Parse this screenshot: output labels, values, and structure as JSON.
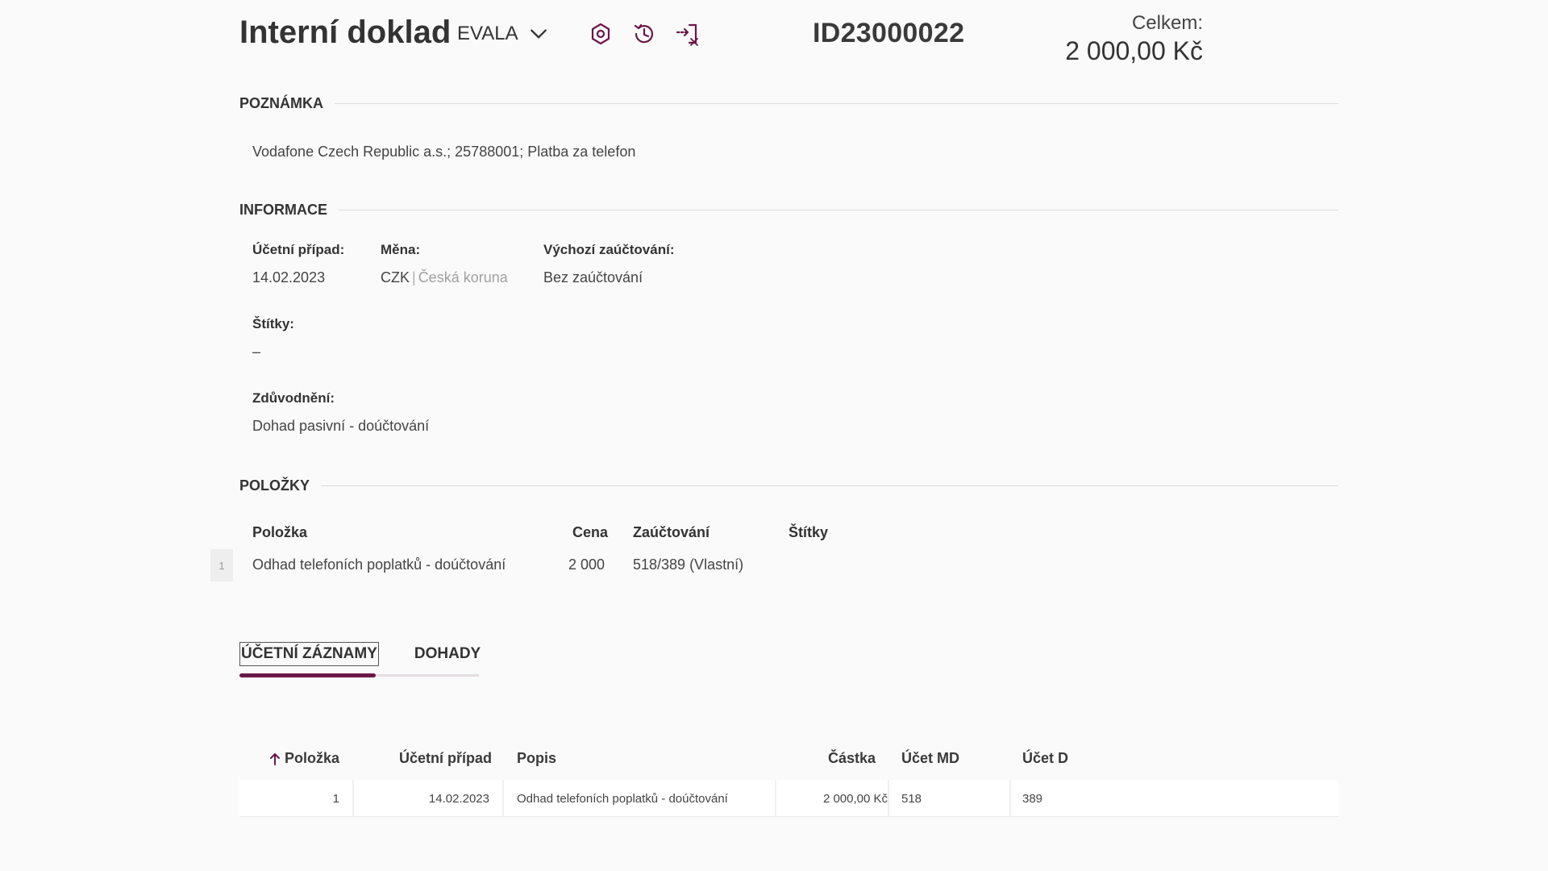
{
  "header": {
    "title": "Interní doklad",
    "company": "EVALA",
    "document_id": "ID23000022",
    "total_label": "Celkem:",
    "total_value": "2 000,00 Kč",
    "icons": [
      "settings-gear-icon",
      "history-clock-icon",
      "export-icon"
    ],
    "accent_color": "#6b1748"
  },
  "note": {
    "title": "POZNÁMKA",
    "text": "Vodafone Czech Republic a.s.; 25788001; Platba za telefon"
  },
  "info": {
    "title": "INFORMACE",
    "accounting_case_label": "Účetní případ:",
    "accounting_case_value": "14.02.2023",
    "currency_label": "Měna:",
    "currency_code": "CZK",
    "currency_separator": "|",
    "currency_name": "Česká koruna",
    "default_posting_label": "Výchozí zaúčtování:",
    "default_posting_value": "Bez zaúčtování",
    "tags_label": "Štítky:",
    "tags_value": "–",
    "justification_label": "Zdůvodnění:",
    "justification_value": "Dohad pasivní - doúčtování"
  },
  "items": {
    "title": "POLOŽKY",
    "columns": {
      "item": "Položka",
      "price": "Cena",
      "posting": "Zaúčtování",
      "tags": "Štítky"
    },
    "rows": [
      {
        "num": "1",
        "item": "Odhad telefoních poplatků - doúčtování",
        "price": "2 000",
        "posting": "518/389 (Vlastní)",
        "tags": ""
      }
    ]
  },
  "tabs": {
    "records": "ÚČETNÍ ZÁZNAMY",
    "estimates": "DOHADY"
  },
  "records": {
    "columns": {
      "item": "Položka",
      "case": "Účetní případ",
      "desc": "Popis",
      "amount": "Částka",
      "debit": "Účet MD",
      "credit": "Účet D"
    },
    "rows": [
      {
        "item": "1",
        "case": "14.02.2023",
        "desc": "Odhad telefoních poplatků - doúčtování",
        "amount": "2 000,00 Kč",
        "debit": "518",
        "credit": "389"
      }
    ]
  }
}
